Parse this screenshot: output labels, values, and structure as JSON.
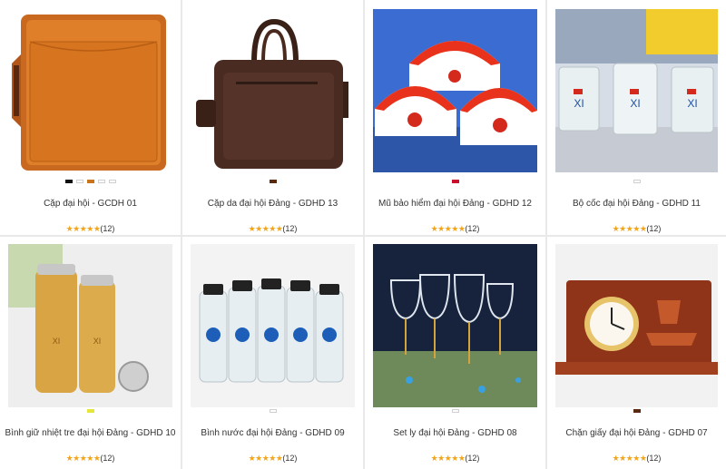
{
  "products": [
    {
      "name": "Cặp đại hội - GCDH 01",
      "stars": "★★★★★",
      "reviews": "(12)",
      "swatches": [
        "#111111",
        "#ffffff",
        "#c8741f",
        "#ffffff",
        "#ffffff"
      ],
      "image": "orange-leather-folder"
    },
    {
      "name": "Cặp da đại hội Đảng - GDHD 13",
      "stars": "★★★★★",
      "reviews": "(12)",
      "swatches": [
        "#5a2a10"
      ],
      "image": "brown-leather-bag"
    },
    {
      "name": "Mũ bảo hiểm đại hội Đảng - GDHD 12",
      "stars": "★★★★★",
      "reviews": "(12)",
      "swatches": [
        "#c8102e"
      ],
      "image": "red-white-helmets"
    },
    {
      "name": "Bộ cốc đại hội Đảng - GDHD 11",
      "stars": "★★★★★",
      "reviews": "(12)",
      "swatches": [
        "#ffffff"
      ],
      "image": "glass-cups"
    },
    {
      "name": "Bình giữ nhiệt tre đại hội Đảng - GDHD 10",
      "stars": "★★★★★",
      "reviews": "(12)",
      "swatches": [
        "#e6e63a"
      ],
      "image": "bamboo-flasks"
    },
    {
      "name": "Bình nước đại hội Đảng - GDHD 09",
      "stars": "★★★★★",
      "reviews": "(12)",
      "swatches": [
        "#ffffff"
      ],
      "image": "water-bottles"
    },
    {
      "name": "Set ly đại hội Đảng - GDHD 08",
      "stars": "★★★★★",
      "reviews": "(12)",
      "swatches": [
        "#ffffff"
      ],
      "image": "wine-glasses"
    },
    {
      "name": "Chặn giấy đại hội Đảng - GDHD 07",
      "stars": "★★★★★",
      "reviews": "(12)",
      "swatches": [
        "#5a2a10"
      ],
      "image": "wooden-clock"
    }
  ]
}
